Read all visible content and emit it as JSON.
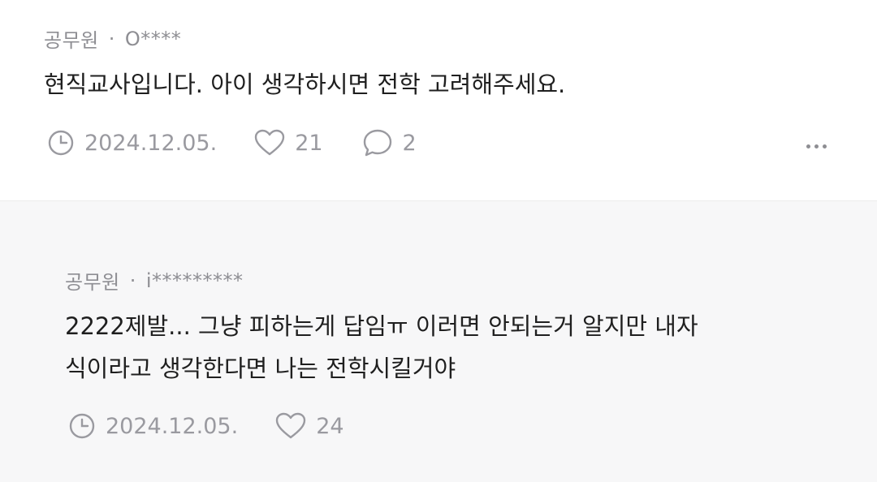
{
  "comments": [
    {
      "category": "공무원",
      "separator": "·",
      "user": "O****",
      "text": "현직교사입니다. 아이 생각하시면 전학 고려해주세요.",
      "date": "2024.12.05.",
      "likes": "21",
      "replies": "2"
    },
    {
      "category": "공무원",
      "separator": "·",
      "user": "i*********",
      "text": "2222제발... 그냥 피하는게 답임ㅠ 이러면 안되는거 알지만 내자\n식이라고 생각한다면 나는 전학시킬거야",
      "date": "2024.12.05.",
      "likes": "24"
    }
  ],
  "icons": {
    "date": "clock-icon",
    "likes": "heart-icon",
    "replies": "speech-bubble-icon",
    "more": "more-dots-icon"
  }
}
